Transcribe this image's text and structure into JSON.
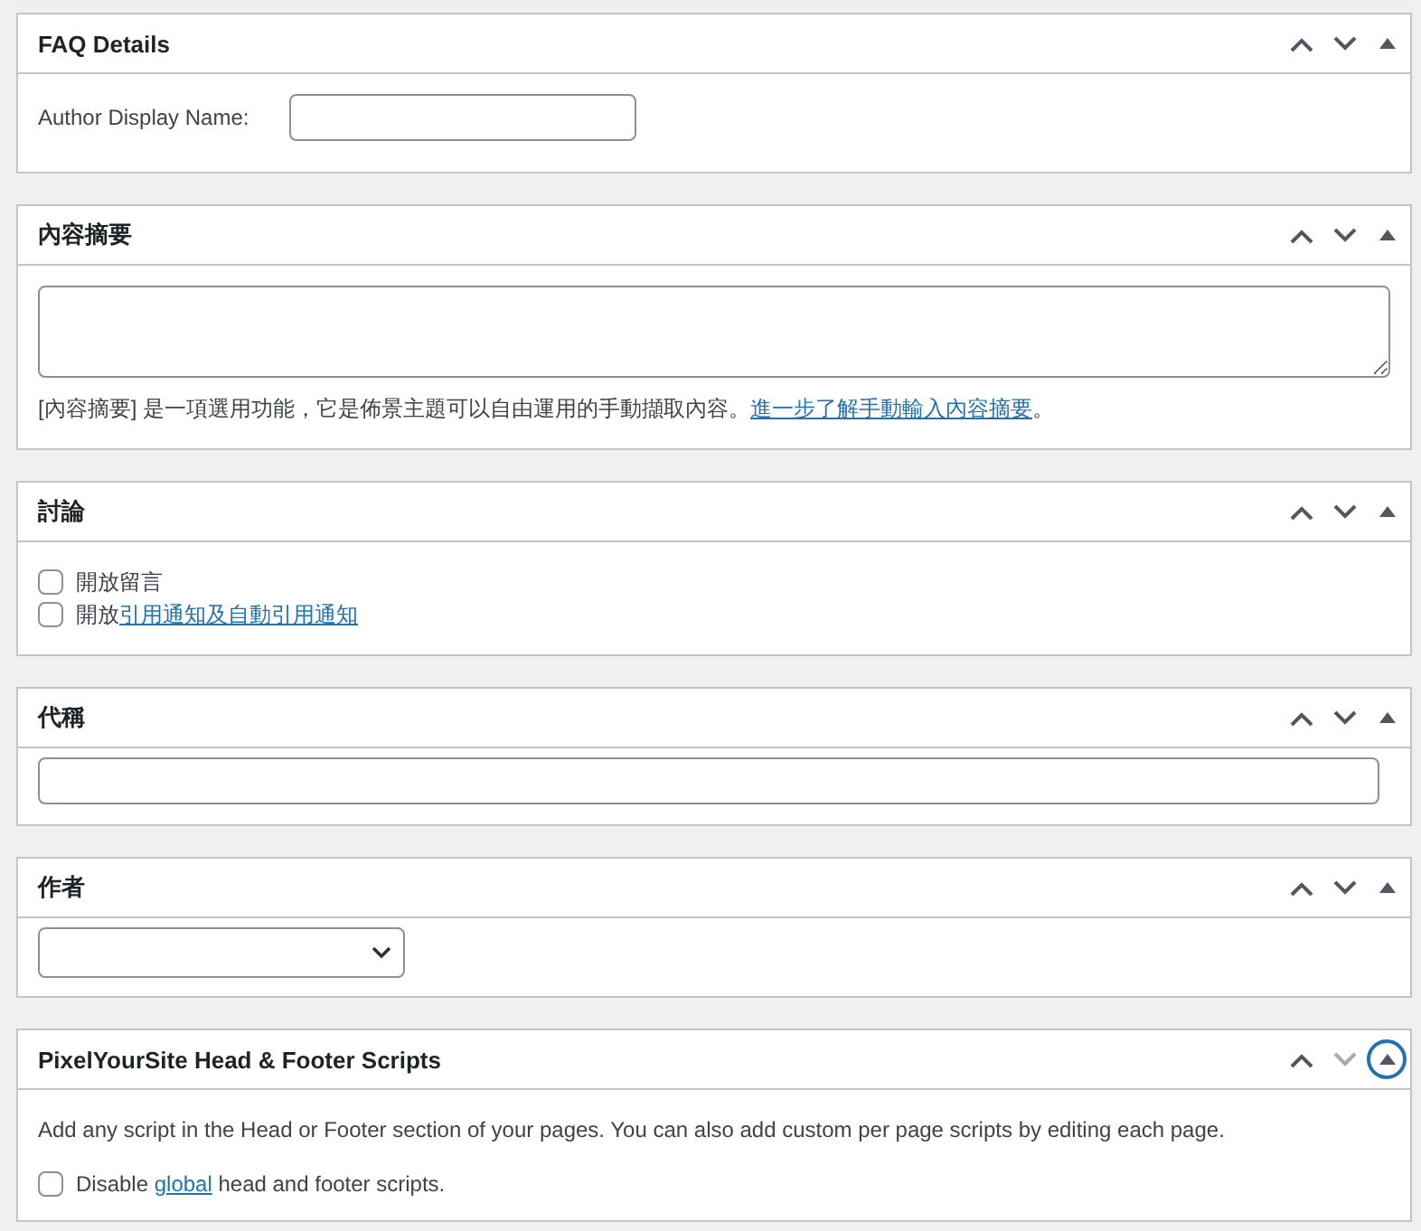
{
  "panels": [
    {
      "kind": "field",
      "title": "FAQ Details",
      "down_disabled": false,
      "toggle_focused": false,
      "label": "Author Display Name:"
    },
    {
      "kind": "textarea",
      "title": "內容摘要",
      "down_disabled": false,
      "toggle_focused": false,
      "help": {
        "before": "[內容摘要] 是一項選用功能，它是佈景主題可以自由運用的手動擷取內容。",
        "link": "進一步了解手動輸入內容摘要",
        "after": "。"
      }
    },
    {
      "kind": "checkboxes",
      "title": "討論",
      "down_disabled": false,
      "toggle_focused": false,
      "options": [
        {
          "before": "開放留言",
          "checked": false
        },
        {
          "before": "開放",
          "link": "引用通知及自動引用通知",
          "checked": false
        }
      ]
    },
    {
      "kind": "input",
      "title": "代稱",
      "down_disabled": false,
      "toggle_focused": false
    },
    {
      "kind": "select",
      "title": "作者",
      "down_disabled": false,
      "toggle_focused": false
    },
    {
      "kind": "scripts",
      "title": "PixelYourSite Head & Footer Scripts",
      "down_disabled": true,
      "toggle_focused": true,
      "description": "Add any script in the Head or Footer section of your pages. You can also add custom per page scripts by editing each page.",
      "options": [
        {
          "before": "Disable ",
          "link": "global",
          "after": " head and footer scripts.",
          "checked": false
        }
      ]
    }
  ]
}
